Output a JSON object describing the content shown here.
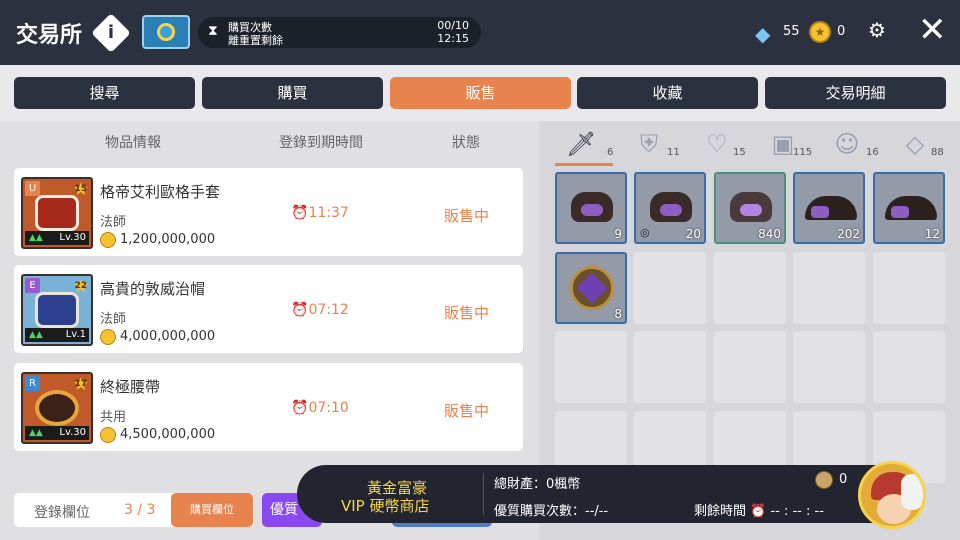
{
  "header": {
    "title": "交易所",
    "info_icon": "info-icon",
    "purchase": {
      "label1": "購買次數",
      "label2": "離重置剩餘",
      "count": "00/10",
      "reset_time": "12:15"
    },
    "diamond_count": "55",
    "coin_count": "0",
    "close_label": "✕"
  },
  "tabs": [
    {
      "label": "搜尋",
      "active": false
    },
    {
      "label": "購買",
      "active": false
    },
    {
      "label": "販售",
      "active": true
    },
    {
      "label": "收藏",
      "active": false
    },
    {
      "label": "交易明細",
      "active": false
    }
  ],
  "columns": {
    "info": "物品情報",
    "expiry": "登錄到期時間",
    "status": "狀態"
  },
  "listings": [
    {
      "grade": "U",
      "stars": "15",
      "level": "Lv.30",
      "name": "格帝艾利歐格手套",
      "class": "法師",
      "price": "1,200,000,000",
      "time": "11:37",
      "status": "販售中"
    },
    {
      "grade": "E",
      "stars": "22",
      "level": "Lv.1",
      "name": "高貴的敦威治帽",
      "class": "法師",
      "price": "4,000,000,000",
      "time": "07:12",
      "status": "販售中"
    },
    {
      "grade": "R",
      "stars": "17",
      "level": "Lv.30",
      "name": "終極腰帶",
      "class": "共用",
      "price": "4,500,000,000",
      "time": "07:10",
      "status": "販售中"
    }
  ],
  "slots": {
    "label": "登錄欄位",
    "count": "3 / 3",
    "buy_button": "購買欄位",
    "premium_button": "優質"
  },
  "categories": [
    {
      "icon": "sword-icon",
      "count": "6",
      "active": true
    },
    {
      "icon": "shield-icon",
      "count": "11",
      "active": false
    },
    {
      "icon": "necklace-icon",
      "count": "15",
      "active": false
    },
    {
      "icon": "briefcase-icon",
      "count": "115",
      "active": false
    },
    {
      "icon": "pet-icon",
      "count": "16",
      "active": false
    },
    {
      "icon": "gem-icon",
      "count": "88",
      "active": false
    }
  ],
  "inventory": [
    {
      "type": "bag",
      "count": "9"
    },
    {
      "type": "bag",
      "count": "20",
      "locked": true
    },
    {
      "type": "bag-green",
      "count": "840"
    },
    {
      "type": "cave",
      "count": "202"
    },
    {
      "type": "cave",
      "count": "12"
    },
    {
      "type": "orb",
      "count": "8"
    }
  ],
  "vip": {
    "title1": "黃金富豪",
    "title2": "VIP 硬幣商店",
    "total_assets": "總財產：0楓幣",
    "premium_buys": "優質購買次數：--/--",
    "remaining_time": "剩餘時間 ⏰ -- : -- : --",
    "coin_count": "0"
  },
  "colors": {
    "accent": "#e9834e",
    "dark": "#2c3140",
    "vip_gold": "#f5d34a"
  }
}
